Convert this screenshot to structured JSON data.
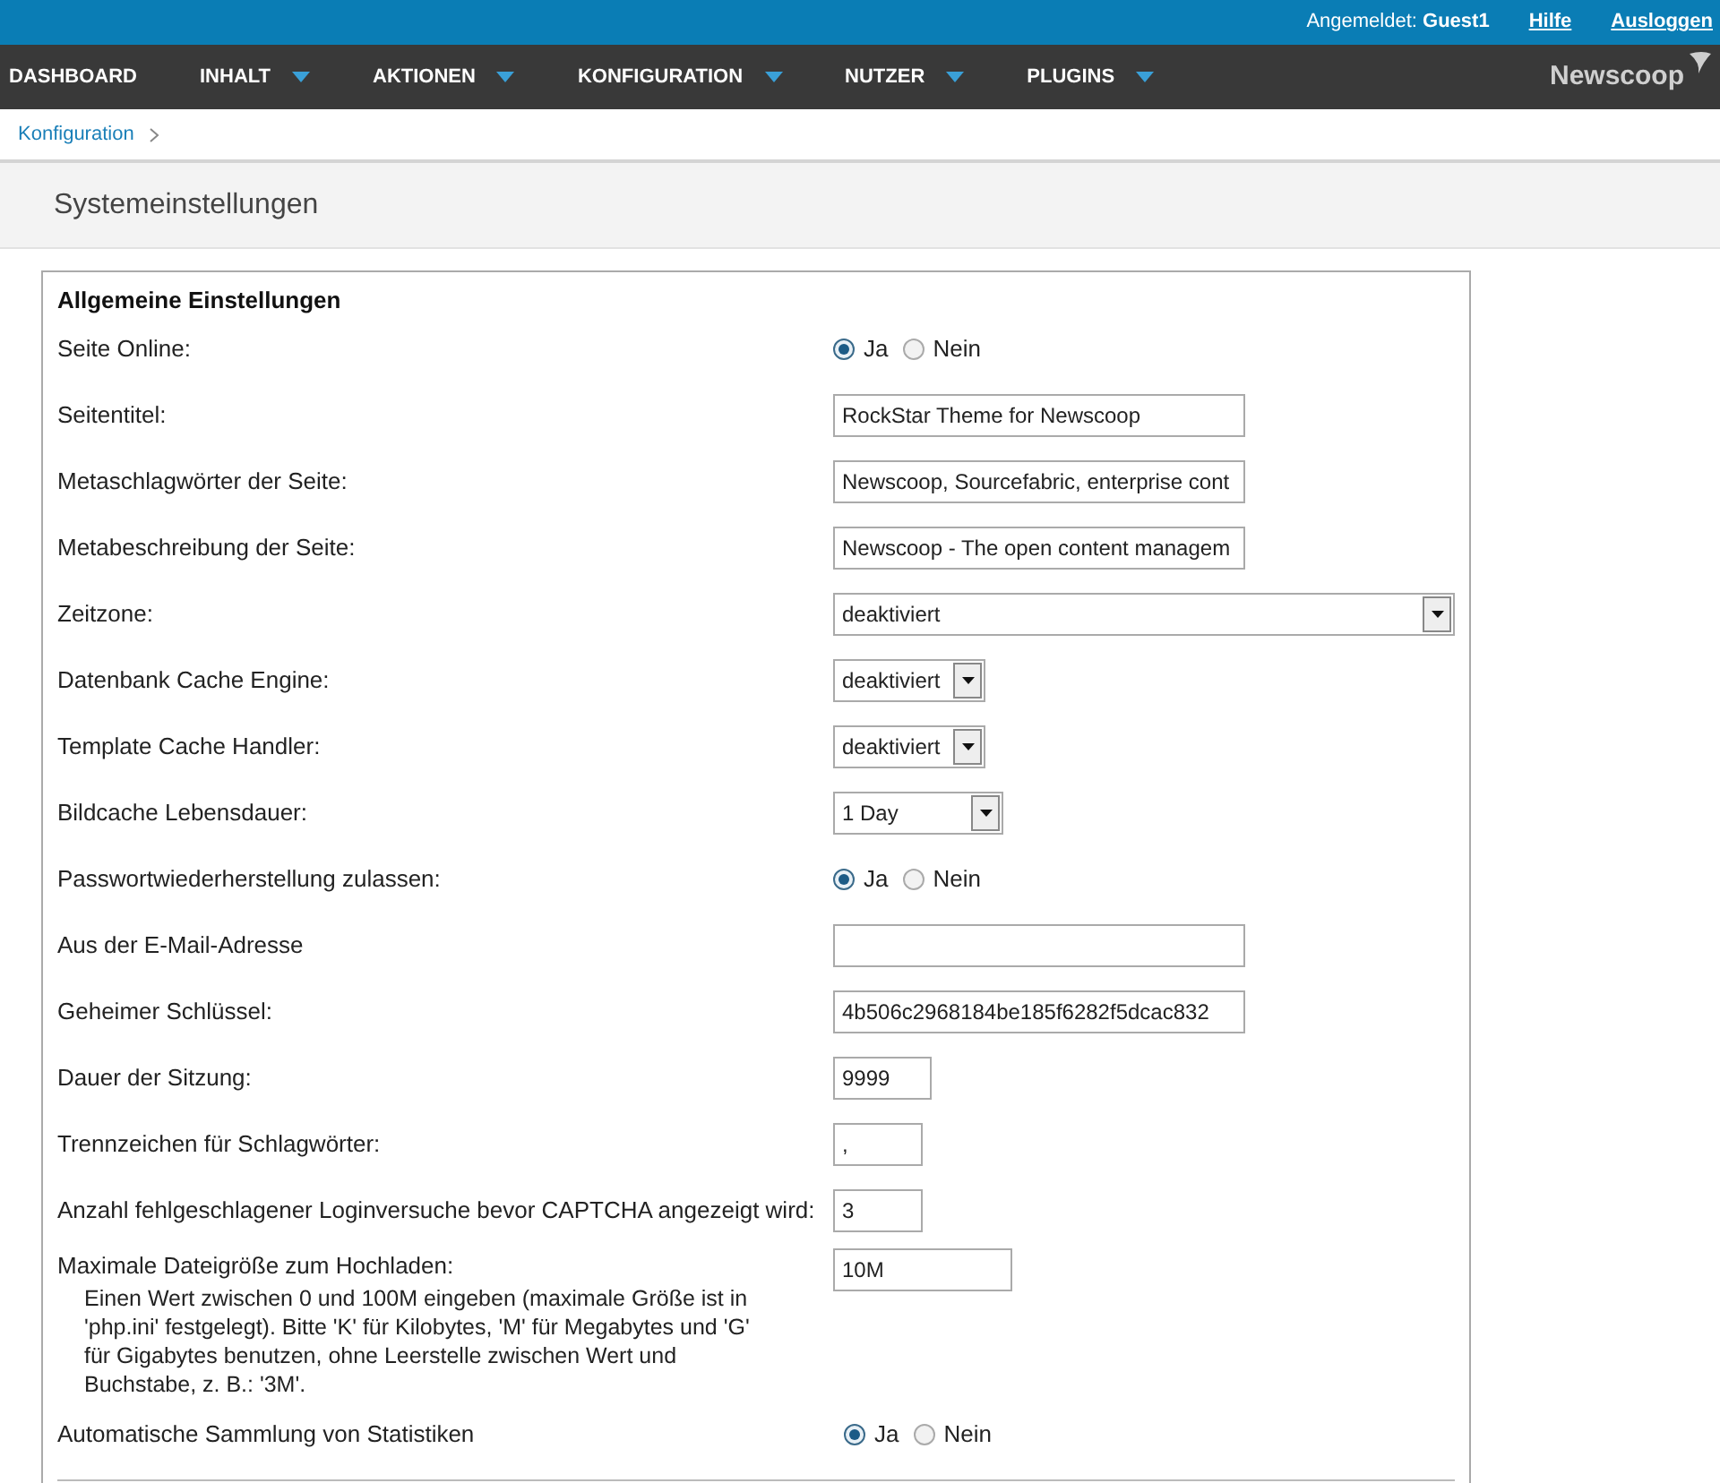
{
  "top_bar": {
    "logged_in_label": "Angemeldet:",
    "user": "Guest1",
    "links": [
      "Hilfe",
      "Ausloggen"
    ]
  },
  "nav": {
    "items": [
      {
        "label": "DASHBOARD",
        "dropdown": false
      },
      {
        "label": "INHALT",
        "dropdown": true
      },
      {
        "label": "AKTIONEN",
        "dropdown": true
      },
      {
        "label": "KONFIGURATION",
        "dropdown": true
      },
      {
        "label": "NUTZER",
        "dropdown": true
      },
      {
        "label": "PLUGINS",
        "dropdown": true
      }
    ],
    "logo": "Newscoop"
  },
  "breadcrumb": [
    "Konfiguration"
  ],
  "page_title": "Systemeinstellungen",
  "section": {
    "title": "Allgemeine Einstellungen",
    "rows": [
      {
        "kind": "radio",
        "label": "Seite Online:",
        "options": [
          {
            "label": "Ja",
            "selected": true
          },
          {
            "label": "Nein",
            "selected": false
          }
        ]
      },
      {
        "kind": "text",
        "label": "Seitentitel:",
        "value": "RockStar Theme for Newscoop"
      },
      {
        "kind": "text",
        "label": "Metaschlagwörter der Seite:",
        "value": "Newscoop, Sourcefabric, enterprise cont"
      },
      {
        "kind": "text",
        "label": "Metabeschreibung der Seite:",
        "value": "Newscoop - The open content managem"
      },
      {
        "kind": "select",
        "label": "Zeitzone:",
        "value": "deaktiviert"
      },
      {
        "kind": "select",
        "label": "Datenbank Cache Engine:",
        "value": "deaktiviert"
      },
      {
        "kind": "select",
        "label": "Template Cache Handler:",
        "value": "deaktiviert"
      },
      {
        "kind": "select",
        "label": "Bildcache Lebensdauer:",
        "value": "1 Day"
      },
      {
        "kind": "radio",
        "label": "Passwortwiederherstellung zulassen:",
        "options": [
          {
            "label": "Ja",
            "selected": true
          },
          {
            "label": "Nein",
            "selected": false
          }
        ]
      },
      {
        "kind": "text",
        "label": "Aus der E-Mail-Adresse"
      },
      {
        "kind": "text",
        "label": "Geheimer Schlüssel:",
        "value": "4b506c2968184be185f6282f5dcac832"
      },
      {
        "kind": "text",
        "label": "Dauer der Sitzung:",
        "value": "9999"
      },
      {
        "kind": "text",
        "label": "Trennzeichen für Schlagwörter:",
        "value": ","
      },
      {
        "kind": "text",
        "label": "Anzahl fehlgeschlagener Loginversuche bevor CAPTCHA angezeigt wird:",
        "value": "3"
      },
      {
        "kind": "text",
        "label": "Maximale Dateigröße zum Hochladen:",
        "value": "10M",
        "help": "Einen Wert zwischen 0 und 100M eingeben (maximale Größe ist in 'php.ini' festgelegt). Bitte 'K' für Kilobytes, 'M' für Megabytes und 'G' für Gigabytes benutzen, ohne Leerstelle zwischen Wert und Buchstabe, z. B.: '3M'."
      },
      {
        "kind": "radio",
        "label": "Automatische Sammlung von Statistiken",
        "options": [
          {
            "label": "Ja",
            "selected": true
          },
          {
            "label": "Nein",
            "selected": false
          }
        ]
      }
    ]
  }
}
